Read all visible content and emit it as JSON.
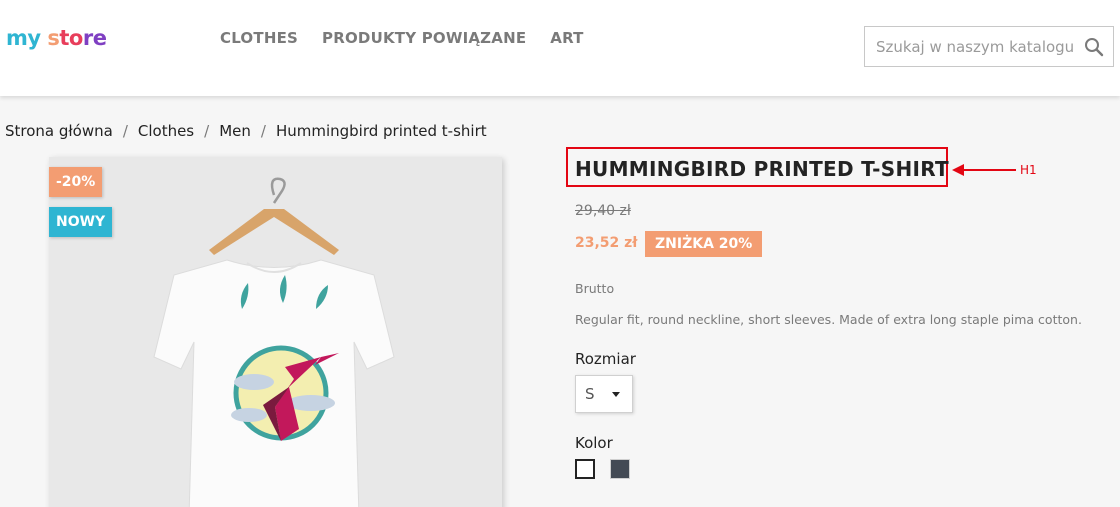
{
  "header": {
    "logo": {
      "part1": "my ",
      "part2": "s",
      "part3": "to",
      "part4": "re"
    },
    "nav": [
      "CLOTHES",
      "PRODUKTY POWIĄZANE",
      "ART"
    ],
    "search": {
      "placeholder": "Szukaj w naszym katalogu",
      "icon": "search-icon"
    }
  },
  "breadcrumb": [
    "Strona główna",
    "Clothes",
    "Men",
    "Hummingbird printed t-shirt"
  ],
  "product": {
    "badges": {
      "discount": "-20%",
      "new": "NOWY"
    },
    "title": "HUMMINGBIRD PRINTED T-SHIRT",
    "annotation_label": "H1",
    "old_price": "29,40 zł",
    "new_price": "23,52 zł",
    "discount_tag": "ZNIŻKA 20%",
    "tax_label": "Brutto",
    "description": "Regular fit, round neckline, short sleeves. Made of extra long staple pima cotton.",
    "size": {
      "label": "Rozmiar",
      "selected": "S"
    },
    "color": {
      "label": "Kolor",
      "swatches": [
        "white",
        "black"
      ]
    }
  },
  "colors": {
    "accent_blue": "#2fb5d2",
    "accent_orange": "#f39d72",
    "annotation_red": "#e30613"
  }
}
